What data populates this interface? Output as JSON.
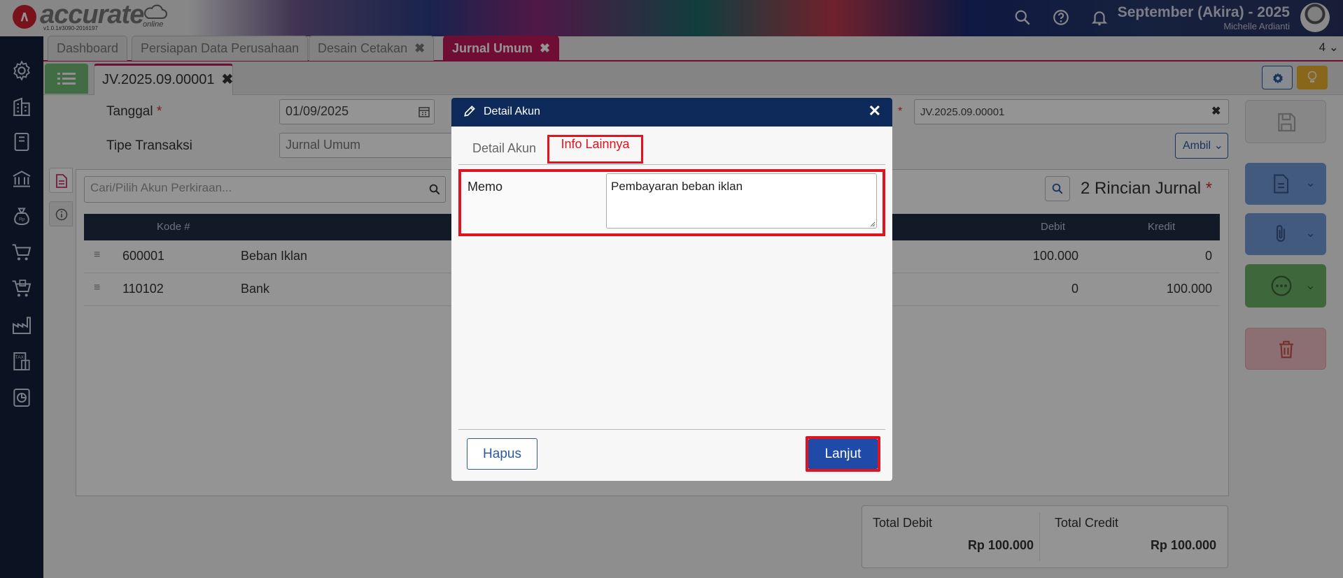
{
  "header": {
    "logo_text": "accurate",
    "logo_sub": "online",
    "version": "v1.0.1#3090-2016197",
    "company": "September (Akira) - 2025",
    "user": "Michelle Ardianti",
    "icons": [
      "search-icon",
      "help-icon",
      "bell-icon"
    ]
  },
  "sidebar": {
    "icons": [
      "gear-icon",
      "building-icon",
      "book-icon",
      "bank-icon",
      "money-bag-icon",
      "cart-icon",
      "cart-box-icon",
      "factory-icon",
      "tax-icon",
      "report-icon"
    ]
  },
  "tabs": [
    {
      "label": "Dashboard",
      "closable": false,
      "active": false
    },
    {
      "label": "Persiapan Data Perusahaan",
      "closable": false,
      "active": false
    },
    {
      "label": "Desain Cetakan",
      "closable": true,
      "active": false
    },
    {
      "label": "Jurnal Umum",
      "closable": true,
      "active": true
    }
  ],
  "tab_count": "4",
  "doc_tab": {
    "label": "JV.2025.09.00001"
  },
  "form": {
    "tanggal_label": "Tanggal",
    "tanggal_value": "01/09/2025",
    "tipe_label": "Tipe Transaksi",
    "tipe_value": "Jurnal Umum",
    "number_value": "JV.2025.09.00001",
    "ambil_label": "Ambil"
  },
  "panel": {
    "search_placeholder": "Cari/Pilih Akun Perkiraan...",
    "rincian_title": "2 Rincian Jurnal",
    "columns": {
      "kode": "Kode #",
      "debit": "Debit",
      "kredit": "Kredit"
    },
    "rows": [
      {
        "kode": "600001",
        "nama": "Beban Iklan",
        "debit": "100.000",
        "kredit": "0"
      },
      {
        "kode": "110102",
        "nama": "Bank",
        "debit": "0",
        "kredit": "100.000"
      }
    ]
  },
  "totals": {
    "debit_label": "Total Debit",
    "debit_value": "Rp 100.000",
    "credit_label": "Total Credit",
    "credit_value": "Rp 100.000"
  },
  "modal": {
    "title": "Detail Akun",
    "tab_detail": "Detail Akun",
    "tab_info": "Info Lainnya",
    "memo_label": "Memo",
    "memo_value": "Pembayaran beban iklan",
    "hapus": "Hapus",
    "lanjut": "Lanjut"
  },
  "colors": {
    "accent_tab": "#c2185b",
    "highlight": "#e0141e",
    "primary": "#1f4aa8",
    "sidebar": "#14213d"
  }
}
